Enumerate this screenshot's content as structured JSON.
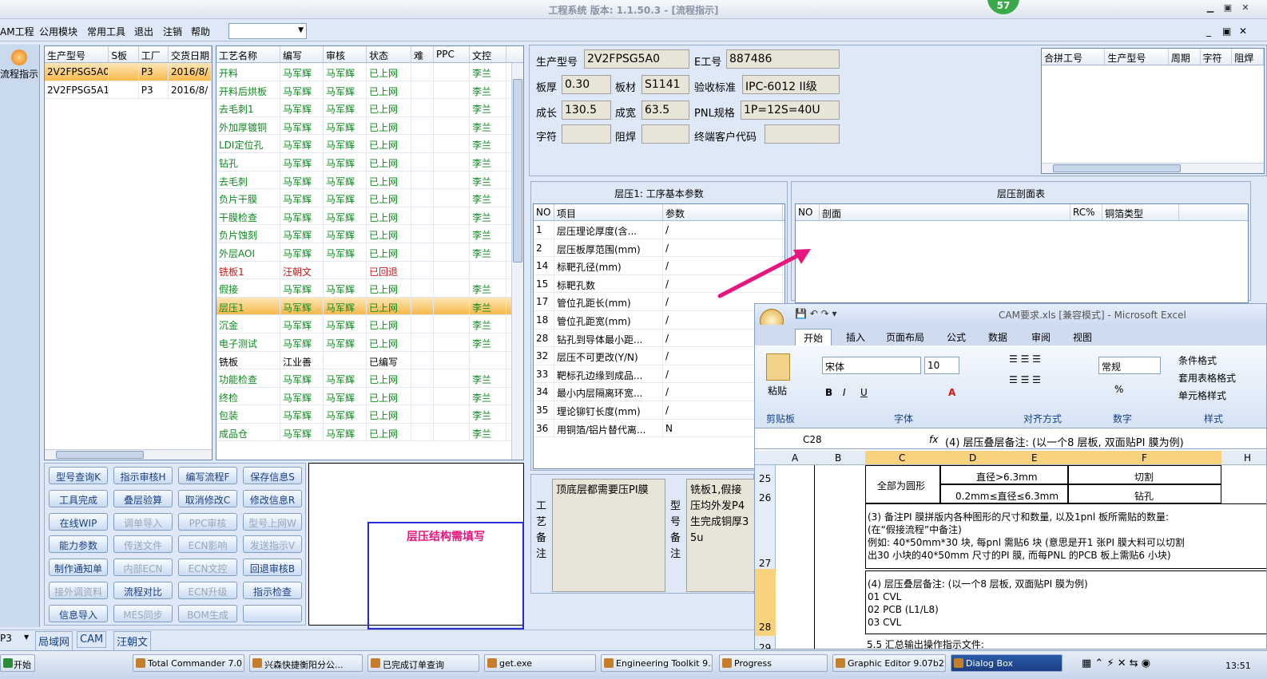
{
  "window": {
    "title": "工程系统  版本: 1.1.50.3 - [流程指示]",
    "badge": "57"
  },
  "menu": {
    "items": [
      "AM工程",
      "公用模块",
      "常用工具",
      "退出",
      "注销",
      "帮助"
    ]
  },
  "sidebar": {
    "flow_label": "流程指示"
  },
  "orders": {
    "headers": [
      "生产型号",
      "S板",
      "工厂",
      "交货日期"
    ],
    "rows": [
      [
        "2V2FPSG5A0",
        "",
        "P3",
        "2016/8/"
      ],
      [
        "2V2FPSG5A1",
        "",
        "P3",
        "2016/8/"
      ]
    ]
  },
  "process": {
    "headers": [
      "工艺名称",
      "编写",
      "审核",
      "状态",
      "难",
      "PPC",
      "文控"
    ],
    "rows": [
      [
        "开料",
        "马军辉",
        "马军辉",
        "已上网",
        "",
        "",
        "李兰"
      ],
      [
        "开料后烘板",
        "马军辉",
        "马军辉",
        "已上网",
        "",
        "",
        "李兰"
      ],
      [
        "去毛刺1",
        "马军辉",
        "马军辉",
        "已上网",
        "",
        "",
        "李兰"
      ],
      [
        "外加厚镀铜",
        "马军辉",
        "马军辉",
        "已上网",
        "",
        "",
        "李兰"
      ],
      [
        "LDI定位孔",
        "马军辉",
        "马军辉",
        "已上网",
        "",
        "",
        "李兰"
      ],
      [
        "钻孔",
        "马军辉",
        "马军辉",
        "已上网",
        "",
        "",
        "李兰"
      ],
      [
        "去毛刺",
        "马军辉",
        "马军辉",
        "已上网",
        "",
        "",
        "李兰"
      ],
      [
        "负片干膜",
        "马军辉",
        "马军辉",
        "已上网",
        "",
        "",
        "李兰"
      ],
      [
        "干膜检查",
        "马军辉",
        "马军辉",
        "已上网",
        "",
        "",
        "李兰"
      ],
      [
        "负片蚀刻",
        "马军辉",
        "马军辉",
        "已上网",
        "",
        "",
        "李兰"
      ],
      [
        "外层AOI",
        "马军辉",
        "马军辉",
        "已上网",
        "",
        "",
        "李兰"
      ],
      [
        "铣板1",
        "汪朝文",
        "",
        "已回退",
        "",
        "",
        ""
      ],
      [
        "假接",
        "马军辉",
        "马军辉",
        "已上网",
        "",
        "",
        "李兰"
      ],
      [
        "层压1",
        "马军辉",
        "马军辉",
        "已上网",
        "",
        "",
        "李兰"
      ],
      [
        "沉金",
        "马军辉",
        "马军辉",
        "已上网",
        "",
        "",
        "李兰"
      ],
      [
        "电子测试",
        "马军辉",
        "马军辉",
        "已上网",
        "",
        "",
        "李兰"
      ],
      [
        "铣板",
        "江业善",
        "",
        "已编写",
        "",
        "",
        ""
      ],
      [
        "功能检查",
        "马军辉",
        "马军辉",
        "已上网",
        "",
        "",
        "李兰"
      ],
      [
        "终检",
        "马军辉",
        "马军辉",
        "已上网",
        "",
        "",
        "李兰"
      ],
      [
        "包装",
        "马军辉",
        "马军辉",
        "已上网",
        "",
        "",
        "李兰"
      ],
      [
        "成品仓",
        "马军辉",
        "马军辉",
        "已上网",
        "",
        "",
        "李兰"
      ]
    ]
  },
  "buttons": [
    [
      "型号查询K",
      "指示审核H",
      "编写流程F",
      "保存信息S"
    ],
    [
      "工具完成",
      "叠层验算",
      "取消修改C",
      "修改信息R"
    ],
    [
      "在线WIP",
      "调单导入",
      "PPC审核",
      "型号上网W"
    ],
    [
      "能力参数",
      "传送文件",
      "ECN影响",
      "发送指示V"
    ],
    [
      "制作通知单",
      "内部ECN",
      "ECN文控",
      "回退审核B"
    ],
    [
      "接外调资料",
      "流程对比",
      "ECN升级",
      "指示检查"
    ],
    [
      "信息导入",
      "MES同步",
      "BOM生成",
      ""
    ]
  ],
  "buttons_disabled": [
    [
      false,
      false,
      false,
      false
    ],
    [
      false,
      false,
      false,
      false
    ],
    [
      false,
      true,
      true,
      true
    ],
    [
      false,
      true,
      true,
      true
    ],
    [
      false,
      true,
      true,
      false
    ],
    [
      true,
      false,
      true,
      false
    ],
    [
      false,
      true,
      true,
      false
    ]
  ],
  "annotation": "层压结构需填写",
  "info": {
    "model_label": "生产型号",
    "model": "2V2FPSG5A0",
    "eno_label": "E工号",
    "eno": "887486",
    "thick_label": "板厚",
    "thick": "0.30",
    "mat_label": "板材",
    "mat": "S1141",
    "std_label": "验收标准",
    "std": "IPC-6012 II级",
    "len_label": "成长",
    "len": "130.5",
    "wid_label": "成宽",
    "wid": "63.5",
    "pnl_label": "PNL规格",
    "pnl": "1P=12S=40U",
    "char_label": "字符",
    "char": "",
    "mask_label": "阻焊",
    "mask": "",
    "cust_label": "终端客户代码",
    "cust": ""
  },
  "merge": {
    "headers": [
      "合拼工号",
      "生产型号",
      "周期",
      "字符",
      "阻焊"
    ]
  },
  "params": {
    "title": "层压1: 工序基本参数",
    "headers": [
      "NO",
      "项目",
      "参数"
    ],
    "rows": [
      [
        "1",
        "层压理论厚度(含...",
        "/"
      ],
      [
        "2",
        "层压板厚范围(mm)",
        "/"
      ],
      [
        "14",
        "标靶孔径(mm)",
        "/"
      ],
      [
        "15",
        "标靶孔数",
        "/"
      ],
      [
        "17",
        "管位孔距长(mm)",
        "/"
      ],
      [
        "18",
        "管位孔距宽(mm)",
        "/"
      ],
      [
        "28",
        "钻孔到导体最小距...",
        "/"
      ],
      [
        "32",
        "层压不可更改(Y/N)",
        "/"
      ],
      [
        "33",
        "靶标孔边缘到成品...",
        "/"
      ],
      [
        "34",
        "最小内层隔离环宽...",
        "/"
      ],
      [
        "35",
        "理论铆钉长度(mm)",
        "/"
      ],
      [
        "36",
        "用铜箔/铝片替代离...",
        "N"
      ]
    ]
  },
  "section": {
    "title": "层压剖面表",
    "headers": [
      "NO",
      "剖面",
      "RC%",
      "铜箔类型"
    ]
  },
  "notes": {
    "proc_label": "工艺备注",
    "proc_text": "顶底层都需要压PI膜",
    "model_label": "型号备注",
    "model_text": "铣板1,假接压均外发P4生完成铜厚35u"
  },
  "excel": {
    "title": "CAM要求.xls [兼容模式] - Microsoft Excel",
    "tabs": [
      "开始",
      "插入",
      "页面布局",
      "公式",
      "数据",
      "审阅",
      "视图"
    ],
    "font": "宋体",
    "size": "10",
    "numfmt": "常规",
    "styles": [
      "条件格式",
      "套用表格格式",
      "单元格样式"
    ],
    "groups": [
      "剪贴板",
      "字体",
      "对齐方式",
      "数字",
      "样式"
    ],
    "paste": "粘贴",
    "cellref": "C28",
    "formula": "(4) 层压叠层备注: (以一个8 层板, 双面贴PI 膜为例)",
    "cols": [
      "A",
      "B",
      "C",
      "D",
      "E",
      "F",
      "H"
    ],
    "rows": [
      "25",
      "26",
      "27",
      "28",
      "29"
    ],
    "c_round": "全部为圆形",
    "d25": "直径>6.3mm",
    "d26": "0.2mm≤直径≤6.3mm",
    "f25": "切割",
    "f26": "钻孔",
    "r27": [
      "(3) 备注PI 膜拼版内各种图形的尺寸和数量, 以及1pnl 板所需贴的数量:",
      "(在“假接流程”中备注)",
      "例如: 40*50mm*30 块, 每pnl 需贴6 块 (意思是开1 张PI 膜大料可以切割",
      "出30 小块的40*50mm 尺寸的PI 膜, 而每PNL 的PCB 板上需贴6 小块)"
    ],
    "r28": [
      "(4) 层压叠层备注: (以一个8 层板, 双面贴PI 膜为例)",
      "01 CVL",
      "02 PCB (L1/L8)",
      "03 CVL"
    ],
    "r29": "5.5 汇总输出操作指示文件:"
  },
  "status": {
    "combo": "P3",
    "items": [
      "局域网",
      "CAM",
      "汪朝文"
    ]
  },
  "taskbar": {
    "start": "开始",
    "tasks": [
      "Total Commander 7.0 ...",
      "兴森快捷衡阳分公...",
      "已完成订单查询",
      "get.exe",
      "Engineering Toolkit 9....",
      "Progress",
      "Graphic Editor 9.07b2 ...",
      "Dialog Box"
    ],
    "clock": "13:51"
  },
  "colors": {
    "accent": "#e8157e",
    "green": "#0c8a1e",
    "red": "#d01818"
  }
}
